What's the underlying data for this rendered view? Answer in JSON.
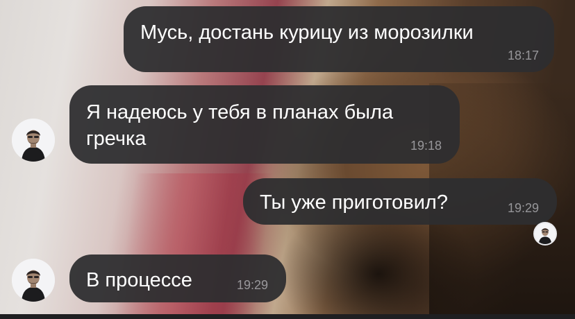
{
  "chat": {
    "messages": [
      {
        "direction": "outgoing",
        "text": "Мусь, достань курицу из морозилки",
        "time": "18:17"
      },
      {
        "direction": "incoming",
        "text": "Я надеюсь у тебя в планах была\nгречка",
        "time": "19:18"
      },
      {
        "direction": "outgoing",
        "text": "Ты уже приготовил?",
        "time": "19:29"
      },
      {
        "direction": "incoming",
        "text": "В процессе",
        "time": "19:29"
      }
    ]
  },
  "icons": {
    "contact_avatar": "contact-avatar-photo",
    "read_receipt_avatar": "read-avatar-photo"
  },
  "colors": {
    "bubble_bg": "#2e2e30",
    "bubble_text": "#ffffff",
    "time_text": "#8f8f94"
  }
}
